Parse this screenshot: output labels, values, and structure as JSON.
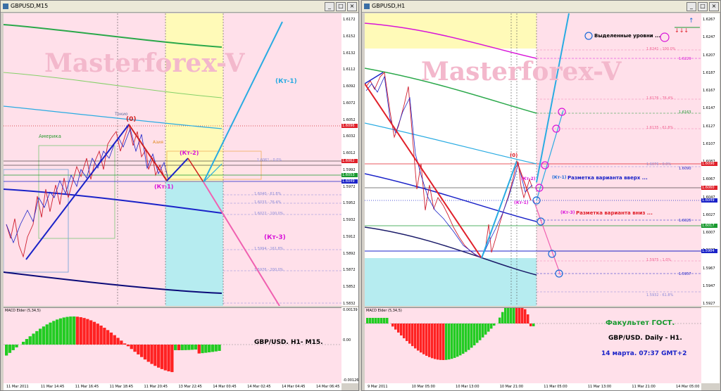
{
  "left": {
    "title": "GBPUSD,M15",
    "watermark": "Masterforex-V",
    "prices": [
      "1.6172",
      "1.6152",
      "1.6132",
      "1.6112",
      "1.6092",
      "1.6072",
      "1.6052",
      "1.6032",
      "1.6012",
      "1.5992",
      "1.5972",
      "1.5952",
      "1.5932",
      "1.5912",
      "1.5892",
      "1.5872",
      "1.5852",
      "1.5832"
    ],
    "price_tags": {
      "a": "1.6096",
      "b": "1.6062",
      "c": "1.6053",
      "d": "1.6049"
    },
    "session_labels": {
      "america": "Америка",
      "tokyo": "Токио",
      "asia": "Азия"
    },
    "wave_labels": {
      "zero": "(0)",
      "kt1": "(Кт-1)",
      "kt2": "(Кт-2)",
      "kt1_right": "(Кт-1)",
      "kt3": "(Кт-3)"
    },
    "fib_levels": [
      "1.6061 - 0.0%",
      "1.6040 - 61.8%",
      "1.6033 - 76.4%",
      "1.6022 - 100.0%",
      "1.5994 - 161.8%",
      "1.5976 - 200.0%"
    ],
    "macd_title": "MACD Elder (5,34,5)",
    "macd_ticks": [
      "0.00139",
      "0.00",
      "-0.00126"
    ],
    "caption": "GBP/USD.  H1- M15.",
    "x_labels": [
      "11 Mar 2011",
      "11 Mar 14:45",
      "11 Mar 16:45",
      "11 Mar 18:45",
      "11 Mar 20:45",
      "13 Mar 22:45",
      "14 Mar 00:45",
      "14 Mar 02:45",
      "14 Mar 04:45",
      "14 Mar 06:45"
    ]
  },
  "right": {
    "title": "GBPUSD,H1",
    "watermark": "Masterforex-V",
    "prices": [
      "1.6267",
      "1.6247",
      "1.6207",
      "1.6187",
      "1.6167",
      "1.6147",
      "1.6127",
      "1.6107",
      "1.6087",
      "1.6067",
      "1.6047",
      "1.6027",
      "1.6007",
      "1.5987",
      "1.5967",
      "1.5947",
      "1.5927"
    ],
    "price_tags": {
      "a": "1.6096",
      "b": "1.6060",
      "c": "1.6049",
      "d": "1.6017",
      "e": "1.5984"
    },
    "wave_labels": {
      "zero": "(0)",
      "kt2": "(Кт-2)",
      "kt1": "(Кт-1)"
    },
    "annotations": {
      "levels": "Выделенные уровни ...",
      "up": "Разметка варианта вверх ...",
      "up_tag": "(Кт-1)",
      "down": "Разметка варианта вниз ...",
      "down_tag": "(Кт-3)"
    },
    "fib_levels": [
      "1.6241 - 100.0%",
      "1.6229",
      "1.6176 - 76.4%",
      "1.6163",
      "1.6135 - 61.8%",
      "1.6076 - 0.0%",
      "1.6090",
      "1.6025",
      "1.5975 - 1.0%",
      "1.5957",
      "1.5932 - 61.8%"
    ],
    "macd_title": "MACD Elder (5,34,5)",
    "caption1": "Факультет ГОСТ.",
    "caption2": "GBP/USD. Daily - H1.",
    "caption3": "14 марта. 07:37 GMT+2",
    "x_labels": [
      "9 Mar 2011",
      "10 Mar 05:00",
      "10 Mar 13:00",
      "10 Mar 21:00",
      "11 Mar 05:00",
      "11 Mar 13:00",
      "11 Mar 21:00",
      "14 Mar 05:00"
    ]
  },
  "colors": {
    "pink": "#ffe0ea",
    "yellow": "#fffab8",
    "cyan": "#b6ecf0",
    "blue": "#1a22c8",
    "red": "#e0202a",
    "sky": "#29abe2",
    "magenta": "#d814d8"
  }
}
